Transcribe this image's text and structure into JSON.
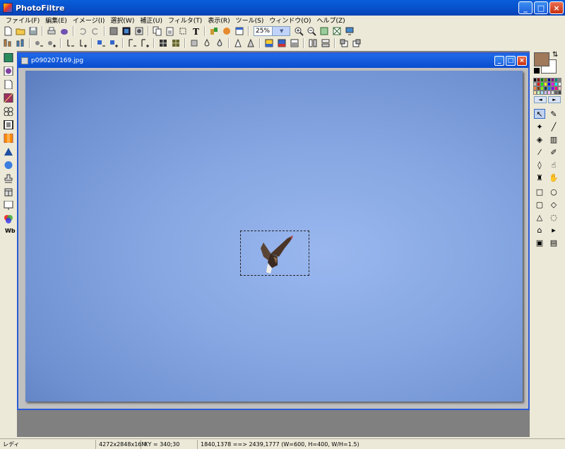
{
  "app": {
    "title": "PhotoFiltre"
  },
  "menu": [
    "ファイル(F)",
    "編集(E)",
    "イメージ(I)",
    "選択(W)",
    "補正(U)",
    "フィルタ(T)",
    "表示(R)",
    "ツール(S)",
    "ウィンドウ(O)",
    "ヘルプ(Z)"
  ],
  "toolbar": {
    "zoom_value": "25%"
  },
  "document": {
    "title": "p090207169.jpg"
  },
  "left_tools": {
    "wb_label": "Wb"
  },
  "status": {
    "state": "レディ",
    "image_info": "4272x2848x16M",
    "xy": "XY = 340;30",
    "selection": "1840,1378 ==> 2439,1777 (W=600, H=400, W/H=1.5)"
  },
  "colors": {
    "foreground": "#a0785a",
    "background": "#ffffff",
    "sky": "#86a7e2"
  }
}
